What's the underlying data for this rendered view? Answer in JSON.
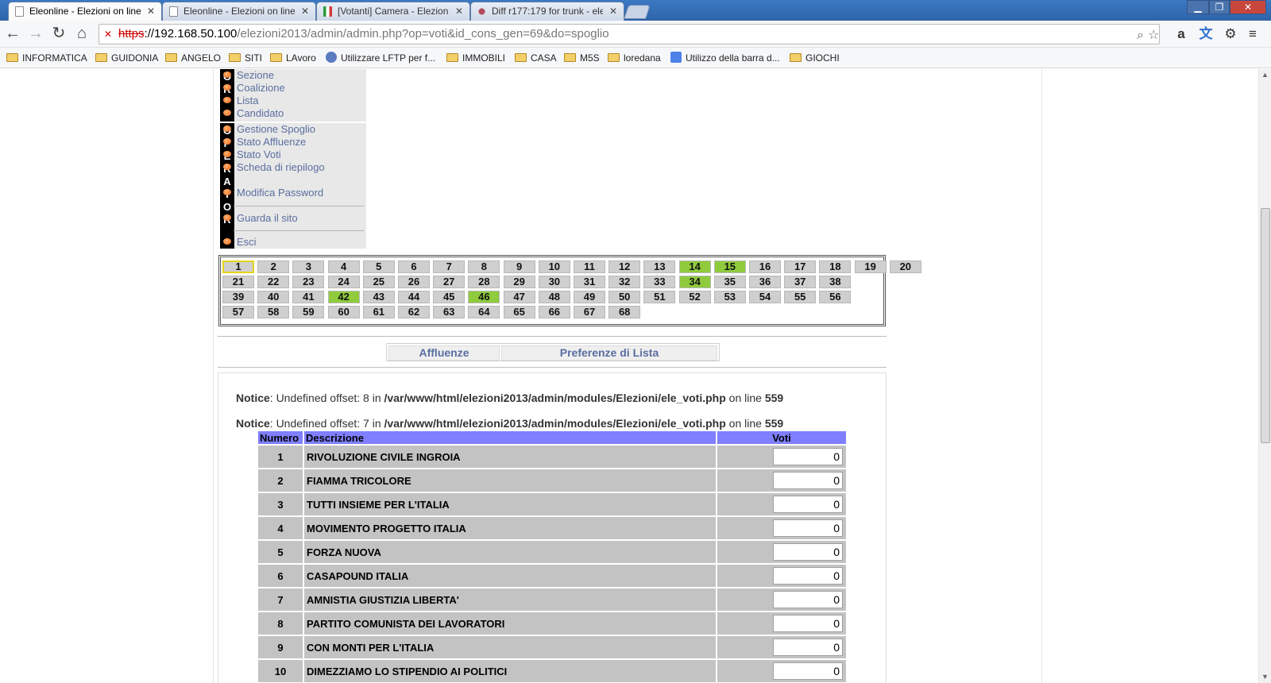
{
  "browser": {
    "tabs": [
      {
        "title": "Eleonline - Elezioni on line",
        "active": true,
        "icon": "page-icon"
      },
      {
        "title": "Eleonline - Elezioni on line",
        "active": false,
        "icon": "page-icon"
      },
      {
        "title": "[Votanti] Camera - Elezioni",
        "active": false,
        "icon": "flag-icon"
      },
      {
        "title": "Diff r177:179 for trunk - ele",
        "active": false,
        "icon": "bug-icon"
      }
    ],
    "url": {
      "protocol": "https",
      "host": "://192.168.50.100",
      "path": "/elezioni2013/admin/admin.php?op=voti&id_cons_gen=69&do=spoglio"
    },
    "bookmarks": [
      {
        "label": "INFORMATICA",
        "icon": "folder-icon"
      },
      {
        "label": "GUIDONIA",
        "icon": "folder-icon"
      },
      {
        "label": "ANGELO",
        "icon": "folder-icon"
      },
      {
        "label": "SITI",
        "icon": "folder-icon"
      },
      {
        "label": "LAvoro",
        "icon": "folder-icon"
      },
      {
        "label": "Utilizzare LFTP per f...",
        "icon": "wordpress-icon"
      },
      {
        "label": "IMMOBILI",
        "icon": "folder-icon"
      },
      {
        "label": "CASA",
        "icon": "folder-icon"
      },
      {
        "label": "M5S",
        "icon": "folder-icon"
      },
      {
        "label": "loredana",
        "icon": "folder-icon"
      },
      {
        "label": "Utilizzo della barra d...",
        "icon": "google-icon"
      },
      {
        "label": "GIOCHI",
        "icon": "folder-icon"
      }
    ]
  },
  "menu": {
    "strip_top": [
      "O",
      "R"
    ],
    "strip_operator": [
      "O",
      "P",
      "E",
      "R",
      "A",
      "T",
      "O",
      "R"
    ],
    "group1": [
      "Sezione",
      "Coalizione",
      "Lista",
      "Candidato"
    ],
    "group2": [
      "Gestione Spoglio",
      "Stato Affluenze",
      "Stato Voti",
      "Scheda di riepilogo"
    ],
    "password": "Modifica Password",
    "site": "Guarda il sito",
    "exit": "Esci"
  },
  "sections": {
    "rows": [
      [
        "1",
        "2",
        "3",
        "4",
        "5",
        "6",
        "7",
        "8",
        "9",
        "10",
        "11",
        "12",
        "13",
        "14",
        "15",
        "16",
        "17",
        "18",
        "19",
        "20"
      ],
      [
        "21",
        "22",
        "23",
        "24",
        "25",
        "26",
        "27",
        "28",
        "29",
        "30",
        "31",
        "32",
        "33",
        "34",
        "35",
        "36",
        "37",
        "38"
      ],
      [
        "39",
        "40",
        "41",
        "42",
        "43",
        "44",
        "45",
        "46",
        "47",
        "48",
        "49",
        "50",
        "51",
        "52",
        "53",
        "54",
        "55",
        "56"
      ],
      [
        "57",
        "58",
        "59",
        "60",
        "61",
        "62",
        "63",
        "64",
        "65",
        "66",
        "67",
        "68"
      ]
    ],
    "completed": [
      "14",
      "15",
      "34",
      "42",
      "46"
    ],
    "current": "1",
    "completed_color": "#8fcb3c"
  },
  "subnav": {
    "affluenze": "Affluenze",
    "preferenze": "Preferenze di Lista"
  },
  "notices": [
    {
      "label": "Notice",
      "text": ": Undefined offset: 8 in ",
      "file": "/var/www/html/elezioni2013/admin/modules/Elezioni/ele_voti.php",
      "online": " on line ",
      "line": "559"
    },
    {
      "label": "Notice",
      "text": ": Undefined offset: 7 in ",
      "file": "/var/www/html/elezioni2013/admin/modules/Elezioni/ele_voti.php",
      "online": " on line ",
      "line": "559"
    }
  ],
  "table": {
    "headers": {
      "numero": "Numero",
      "descrizione": "Descrizione",
      "voti": "Voti"
    },
    "header_color": "#7f7fff",
    "rows": [
      {
        "num": "1",
        "desc": "RIVOLUZIONE CIVILE INGROIA",
        "voti": "0"
      },
      {
        "num": "2",
        "desc": "FIAMMA TRICOLORE",
        "voti": "0"
      },
      {
        "num": "3",
        "desc": "TUTTI INSIEME PER L'ITALIA",
        "voti": "0"
      },
      {
        "num": "4",
        "desc": "MOVIMENTO PROGETTO ITALIA",
        "voti": "0"
      },
      {
        "num": "5",
        "desc": "FORZA NUOVA",
        "voti": "0"
      },
      {
        "num": "6",
        "desc": "CASAPOUND ITALIA",
        "voti": "0"
      },
      {
        "num": "7",
        "desc": "AMNISTIA GIUSTIZIA LIBERTA'",
        "voti": "0"
      },
      {
        "num": "8",
        "desc": "PARTITO COMUNISTA DEI LAVORATORI",
        "voti": "0"
      },
      {
        "num": "9",
        "desc": "CON MONTI PER L'ITALIA",
        "voti": "0"
      },
      {
        "num": "10",
        "desc": "DIMEZZIAMO LO STIPENDIO AI POLITICI",
        "voti": "0"
      }
    ]
  }
}
